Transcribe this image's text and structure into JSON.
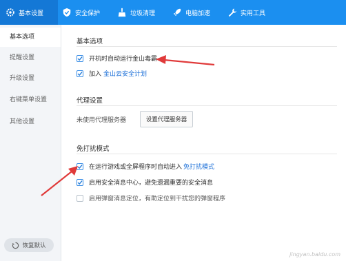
{
  "topbar": {
    "tabs": [
      {
        "label": "基本设置",
        "icon": "gear-icon",
        "active": true
      },
      {
        "label": "安全保护",
        "icon": "shield-icon",
        "active": false
      },
      {
        "label": "垃圾清理",
        "icon": "broom-icon",
        "active": false
      },
      {
        "label": "电脑加速",
        "icon": "rocket-icon",
        "active": false
      },
      {
        "label": "实用工具",
        "icon": "wrench-icon",
        "active": false
      }
    ]
  },
  "sidebar": {
    "items": [
      {
        "label": "基本选项",
        "active": true
      },
      {
        "label": "提醒设置",
        "active": false
      },
      {
        "label": "升级设置",
        "active": false
      },
      {
        "label": "右键菜单设置",
        "active": false
      },
      {
        "label": "其他设置",
        "active": false
      }
    ],
    "restore_label": "恢复默认"
  },
  "main": {
    "basic": {
      "title": "基本选项",
      "autostart_label": "开机时自动运行金山毒霸",
      "cloud_prefix": "加入",
      "cloud_link": "金山云安全计划"
    },
    "proxy": {
      "title": "代理设置",
      "status": "未使用代理服务器",
      "button": "设置代理服务器"
    },
    "nodisturb": {
      "title": "免打扰模式",
      "auto_prefix": "在运行游戏或全屏程序时自动进入",
      "auto_link": "免打扰模式",
      "msg_center": "启用安全消息中心，避免遗漏重要的安全消息",
      "popup_position": "启用弹窗消息定位，有助定位到干扰您的弹窗程序"
    }
  },
  "colors": {
    "accent": "#1b8ff0",
    "arrow": "#e03a3a",
    "link": "#1b6fd8"
  },
  "watermark": "jingyan.baidu.com"
}
